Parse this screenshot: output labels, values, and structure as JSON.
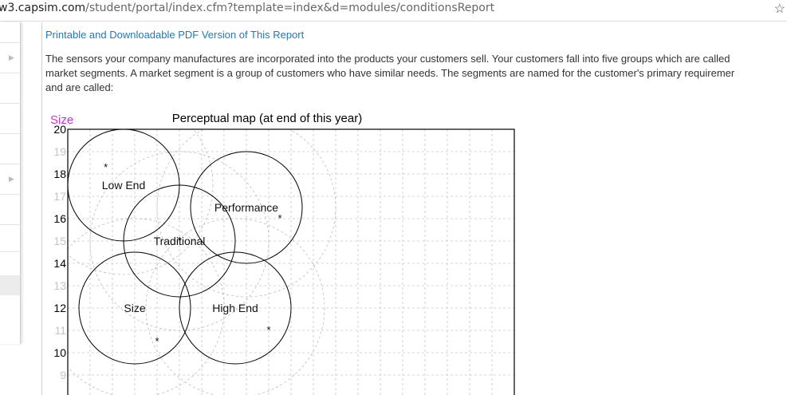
{
  "browser": {
    "url_host": "w3.capsim.com",
    "url_path": "/student/portal/index.cfm?template=index&d=modules/conditionsReport"
  },
  "report": {
    "pdf_link": "Printable and Downloadable PDF Version of This Report",
    "intro_lines": [
      "The sensors your company manufactures are incorporated into the products your customers sell. Your customers fall into five groups which are called",
      "market segments. A market segment is a group of customers who have similar needs. The segments are named for the customer's primary requiremer",
      "and are called:"
    ]
  },
  "colors": {
    "link": "#1a7bbf",
    "axis_label": "#cc33cc",
    "text": "#333333"
  },
  "chart_data": {
    "type": "scatter",
    "title": "Perceptual map (at end of this year)",
    "ylabel": "Size",
    "ylim": [
      8,
      20
    ],
    "xlim": [
      0,
      20
    ],
    "y_ticks": [
      20,
      19,
      18,
      17,
      16,
      15,
      14,
      13,
      12,
      11,
      10,
      9
    ],
    "grid": true,
    "segments": [
      {
        "name": "Low End",
        "center": [
          2.5,
          17.5
        ],
        "radius": 2.5,
        "ideal": [
          1.7,
          18.4
        ]
      },
      {
        "name": "Performance",
        "center": [
          8.0,
          16.5
        ],
        "radius": 2.5,
        "ideal": [
          9.5,
          16.1
        ]
      },
      {
        "name": "Traditional",
        "center": [
          5.0,
          15.0
        ],
        "radius": 2.5,
        "ideal": [
          5.0,
          15.1
        ]
      },
      {
        "name": "High End",
        "center": [
          7.5,
          12.0
        ],
        "radius": 2.5,
        "ideal": [
          9.0,
          11.1
        ]
      },
      {
        "name": "Size",
        "center": [
          3.0,
          12.0
        ],
        "radius": 2.5,
        "ideal": [
          4.0,
          10.6
        ]
      }
    ]
  }
}
